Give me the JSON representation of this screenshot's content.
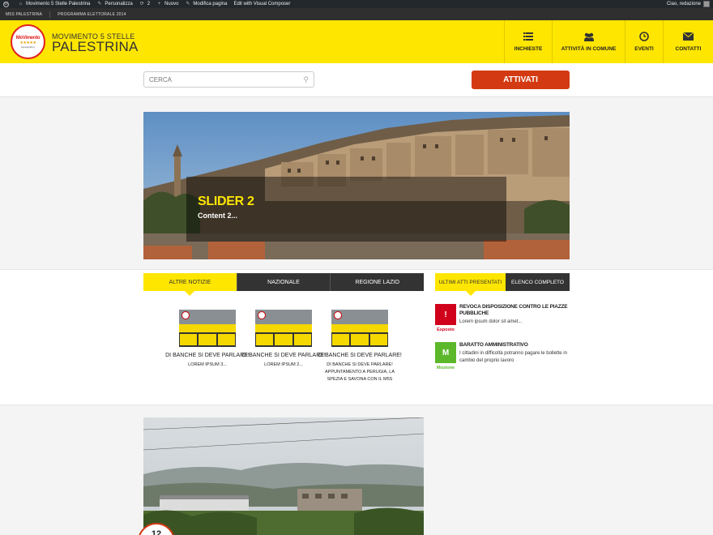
{
  "admin_bar": {
    "site_name": "Movimento 5 Stelle Palestrina",
    "customize": "Personalizza",
    "updates_count": "2",
    "new_label": "Nuovo",
    "edit_page": "Modifica pagina",
    "edit_vc": "Edit with Visual Composer",
    "greeting": "Ciao, redazione"
  },
  "sub_menu": {
    "items": [
      "M5S PALESTRINA",
      "PROGRAMMA ELETTORALE 2014"
    ]
  },
  "header": {
    "logo_text": "MoVimento",
    "logo_stars": "★★★★★",
    "logo_sub": "beppegrillo.it",
    "brand_top": "MOVIMENTO 5 STELLE",
    "brand_main": "PALESTRINA",
    "nav": [
      {
        "label": "INCHIESTE",
        "icon": "list-icon"
      },
      {
        "label": "ATTIVITÀ IN COMUNE",
        "icon": "users-icon"
      },
      {
        "label": "EVENTI",
        "icon": "clock-icon"
      },
      {
        "label": "CONTATTI",
        "icon": "envelope-icon"
      }
    ]
  },
  "search": {
    "placeholder": "CERCA",
    "button": "ATTIVATI"
  },
  "slider": {
    "title": "SLIDER 2",
    "content": "Content 2..."
  },
  "news_tabs": [
    "ALTRE NOTIZIE",
    "NAZIONALE",
    "REGIONE LAZIO"
  ],
  "news": [
    {
      "title": "DI BANCHE SI DEVE PARLARE!",
      "excerpt": "LOREM IPSUM 3..."
    },
    {
      "title": "DI BANCHE SI DEVE PARLARE!",
      "excerpt": "LOREM IPSUM 2..."
    },
    {
      "title": "DI BANCHE SI DEVE PARLARE!",
      "excerpt": "DI BANCHE SI DEVE PARLARE! APPUNTAMENTO A PERUGIA, LA SPEZIA E SAVONA CON IL M5S"
    }
  ],
  "atti_tabs": [
    "ULTIMI ATTI PRESENTATI",
    "ELENCO COMPLETO"
  ],
  "atti": [
    {
      "symbol": "!",
      "status": "Esposto",
      "color": "#d0021b",
      "title": "Revoca disposizione contro le piazze pubbliche",
      "desc": "Lorem ipsum dolor sit amet..."
    },
    {
      "symbol": "M",
      "status": "Mozione",
      "color": "#5cb82a",
      "title": "Baratto amministrativo",
      "desc": "I cittadini in difficoltà potranno pagare le bollette in cambio del proprio lavoro"
    }
  ],
  "event_badge": "12",
  "colors": {
    "brand_yellow": "#ffe600",
    "accent_red": "#d33a13",
    "dark": "#333333"
  }
}
